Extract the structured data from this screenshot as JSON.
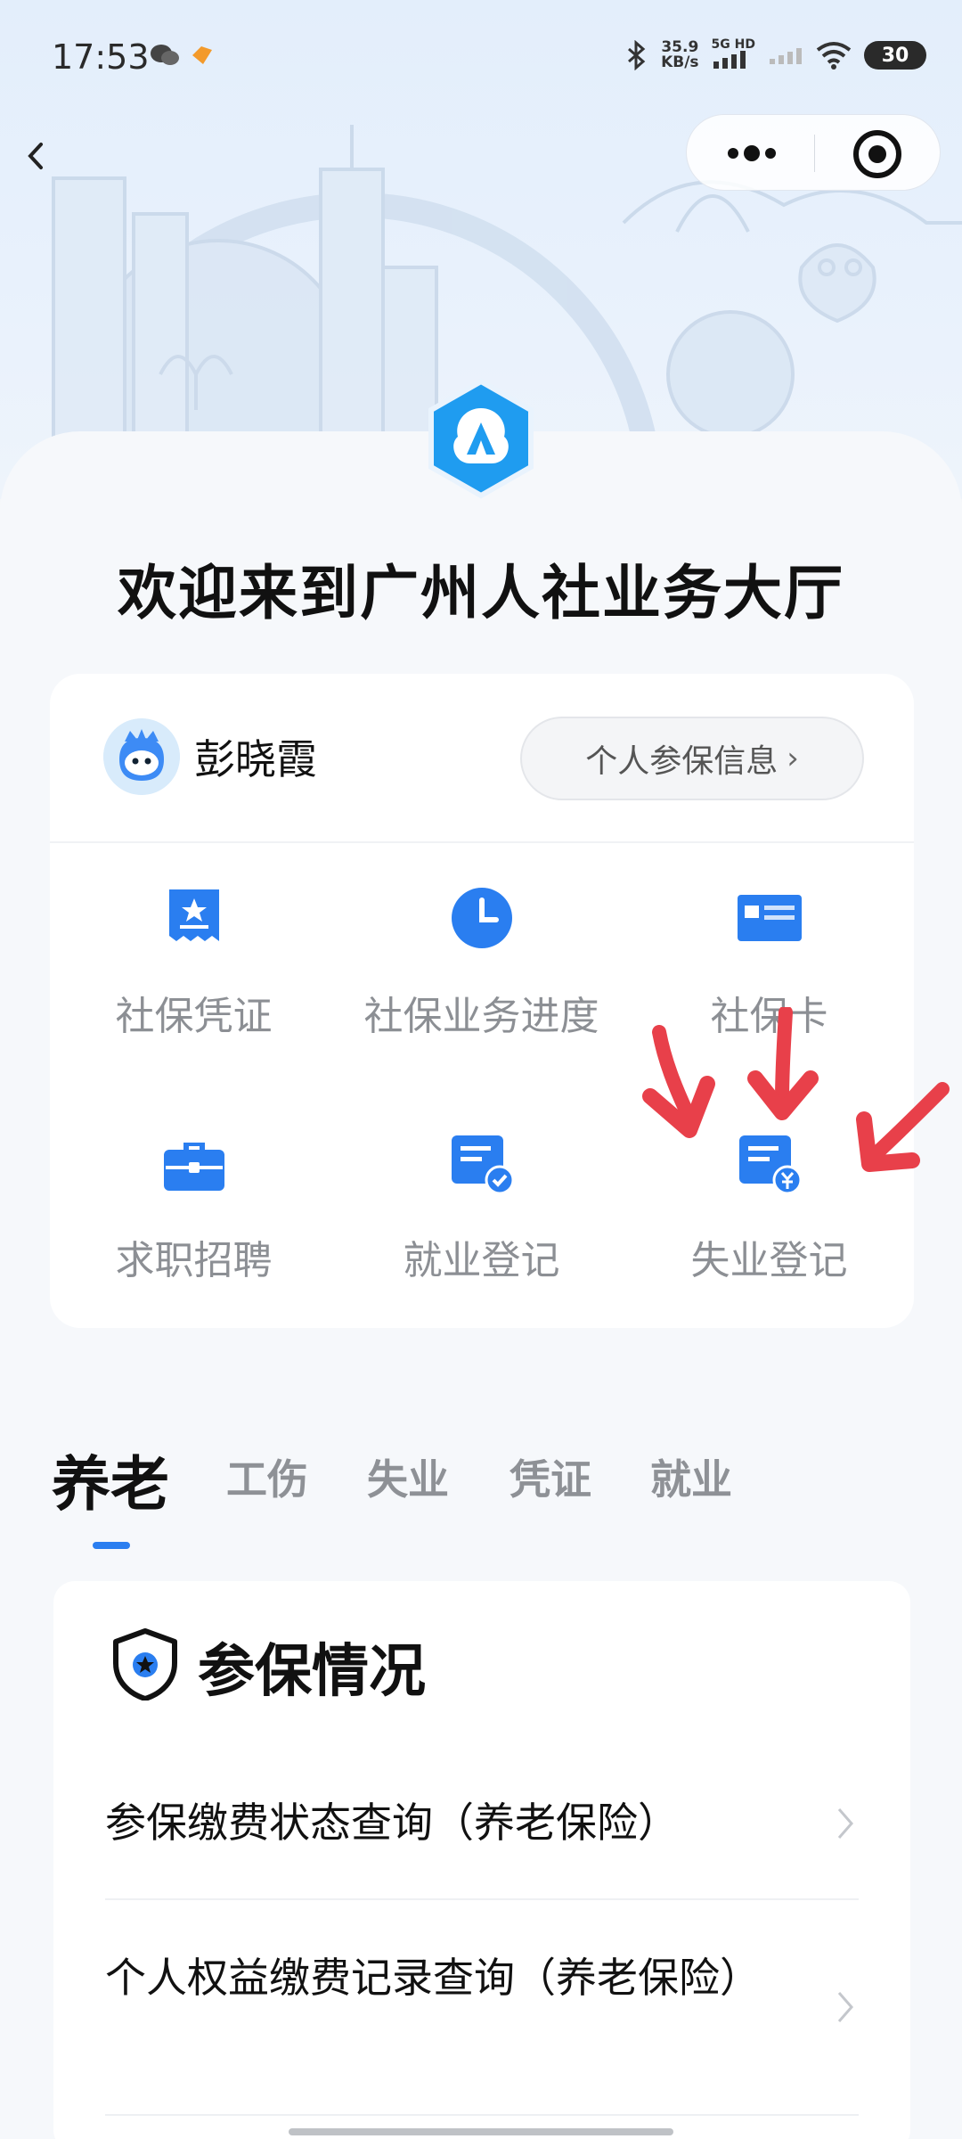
{
  "status_bar": {
    "time": "17:53",
    "speed_value": "35.9",
    "speed_unit": "KB/s",
    "network": "5G HD",
    "battery": "30"
  },
  "header": {
    "welcome_title": "欢迎来到广州人社业务大厅"
  },
  "user": {
    "name": "彭晓霞",
    "info_button_label": "个人参保信息",
    "info_button_chevron": "›"
  },
  "services": [
    {
      "label": "社保凭证",
      "icon": "certificate-icon"
    },
    {
      "label": "社保业务进度",
      "icon": "clock-icon"
    },
    {
      "label": "社保卡",
      "icon": "card-icon"
    },
    {
      "label": "求职招聘",
      "icon": "briefcase-icon"
    },
    {
      "label": "就业登记",
      "icon": "employment-register-icon"
    },
    {
      "label": "失业登记",
      "icon": "unemployment-register-icon"
    }
  ],
  "tabs": [
    {
      "label": "养老",
      "active": true
    },
    {
      "label": "工伤",
      "active": false
    },
    {
      "label": "失业",
      "active": false
    },
    {
      "label": "凭证",
      "active": false
    },
    {
      "label": "就业",
      "active": false
    }
  ],
  "section": {
    "title": "参保情况",
    "items": [
      {
        "label": "参保缴费状态查询（养老保险）"
      },
      {
        "label": "个人权益缴费记录查询（养老保险）"
      }
    ]
  },
  "colors": {
    "accent": "#2a7ef0",
    "icon_blue": "#3d8bf5",
    "annotation_red": "#e8404a"
  }
}
